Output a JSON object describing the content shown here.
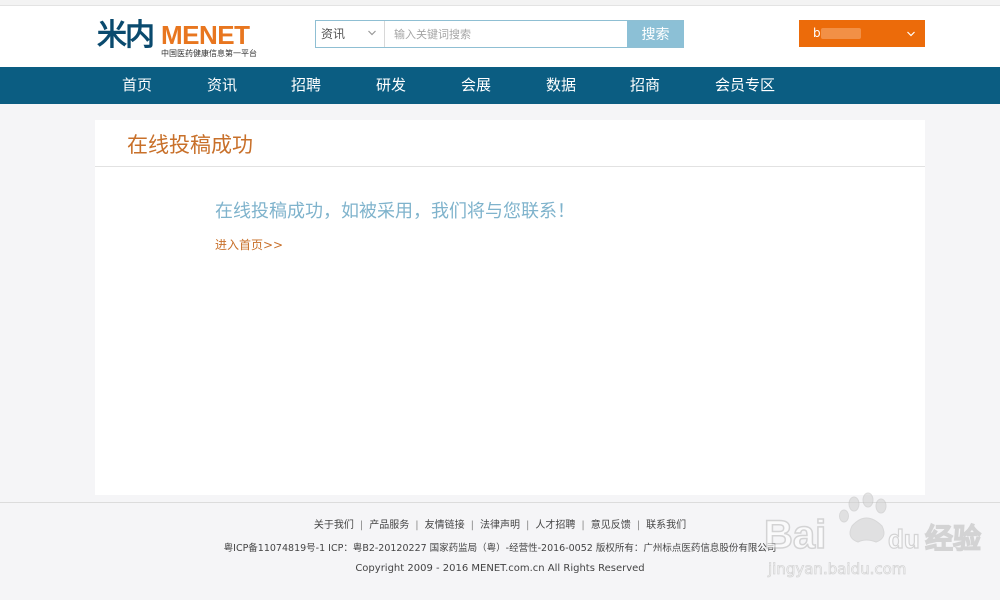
{
  "logo": {
    "brand_cn": "米内",
    "brand_en": "MENET",
    "tagline": "中国医药健康信息第一平台"
  },
  "search": {
    "category": "资讯",
    "placeholder": "输入关键词搜索",
    "button_label": "搜索"
  },
  "user": {
    "name": "b"
  },
  "nav": {
    "items": [
      {
        "label": "首页"
      },
      {
        "label": "资讯"
      },
      {
        "label": "招聘"
      },
      {
        "label": "研发"
      },
      {
        "label": "会展"
      },
      {
        "label": "数据"
      },
      {
        "label": "招商"
      },
      {
        "label": "会员专区"
      }
    ]
  },
  "main": {
    "title": "在线投稿成功",
    "message": "在线投稿成功，如被采用，我们将与您联系！",
    "home_link": "进入首页>>"
  },
  "footer": {
    "links": [
      {
        "label": "关于我们"
      },
      {
        "label": "产品服务"
      },
      {
        "label": "友情链接"
      },
      {
        "label": "法律声明"
      },
      {
        "label": "人才招聘"
      },
      {
        "label": "意见反馈"
      },
      {
        "label": "联系我们"
      }
    ],
    "separator": "|",
    "icp": "粤ICP备11074819号-1 ICP：粤B2-20120227 国家药监局（粤）-经营性-2016-0052 版权所有：广州标点医药信息股份有限公司",
    "copyright": "Copyright 2009 - 2016 MENET.com.cn All Rights Reserved"
  },
  "watermark": {
    "brand": "Bai",
    "brand_tail": "du",
    "brand_cn": "经验",
    "url": "jingyan.baidu.com"
  },
  "colors": {
    "nav_bg": "#0b5d82",
    "accent_orange": "#ec6b0a",
    "title_orange": "#c8702a",
    "message_blue": "#7fb3cc",
    "search_button": "#8cc0d6"
  }
}
